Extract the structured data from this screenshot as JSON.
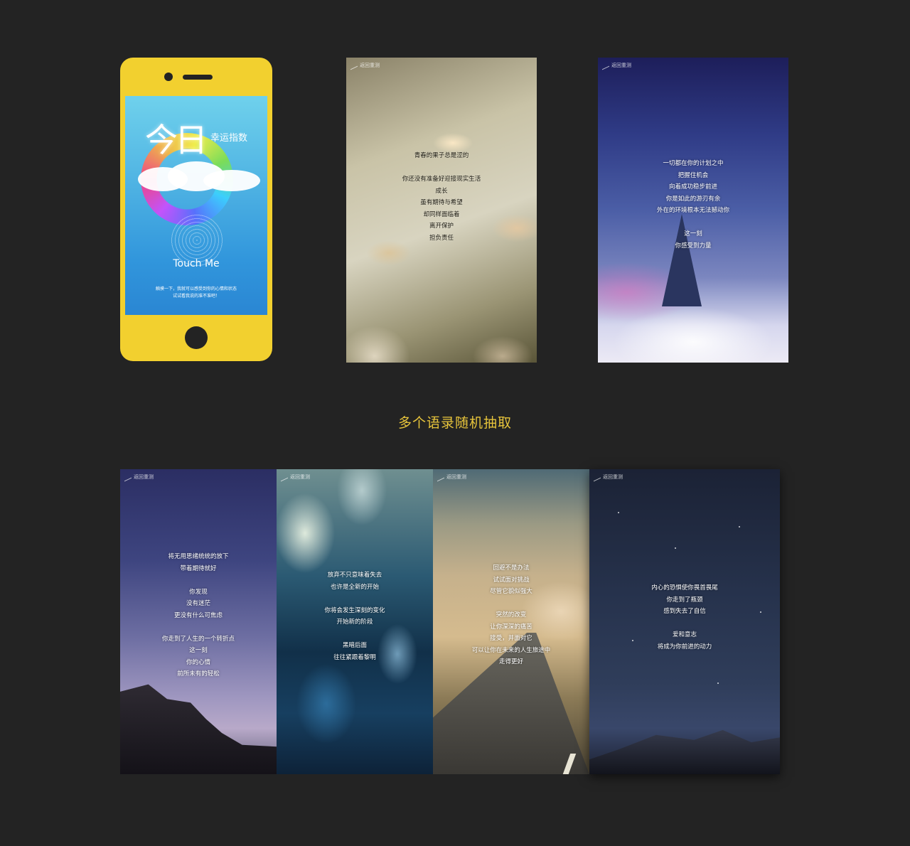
{
  "intro_phone": {
    "title_big": "今日",
    "title_small": "幸运指数",
    "touch_label": "Touch Me",
    "hint_lines": [
      "触摸一下，我就可以感受到你的心情和状态",
      "试试看我说的准不准吧！"
    ]
  },
  "back_label": "返回重测",
  "section_title": "多个语录随机抽取",
  "quotes": {
    "card1": [
      "青春的果子总是涩的",
      "",
      "你还没有准备好迎接现实生活",
      "成长",
      "虽有期待与希望",
      "却同样面临着",
      "离开保护",
      "担负责任"
    ],
    "card2": [
      "一切都在你的计划之中",
      "把握住机会",
      "向着成功稳步前进",
      "你是如此的游刃有余",
      "外在的环境根本无法撼动你",
      "",
      "这一刻",
      "你感受到力量"
    ],
    "card3": [
      "将无用思绪统统的放下",
      "带着期待就好",
      "",
      "你发现",
      "没有迷茫",
      "更没有什么可焦虑",
      "",
      "你走到了人生的一个转折点",
      "这一刻",
      "你的心情",
      "前所未有的轻松"
    ],
    "card4": [
      "放弃不只意味着失去",
      "也许是全新的开始",
      "",
      "你将会发生深刻的变化",
      "开始新的阶段",
      "",
      "黑暗后面",
      "往往紧跟着黎明"
    ],
    "card5": [
      "回避不是办法",
      "试试面对挑战",
      "尽管它貌似强大",
      "",
      "突然的改变",
      "让你深深的痛苦",
      "接受，并面对它",
      "可以让你在未来的人生旅途中",
      "走得更好"
    ],
    "card6": [
      "内心的恐惧使你畏首畏尾",
      "你走到了瓶颈",
      "感到失去了自信",
      "",
      "爱和意志",
      "将成为你前进的动力"
    ]
  },
  "colors": {
    "background": "#232323",
    "phone_body": "#f2d02f",
    "accent_title": "#e7c43b"
  }
}
